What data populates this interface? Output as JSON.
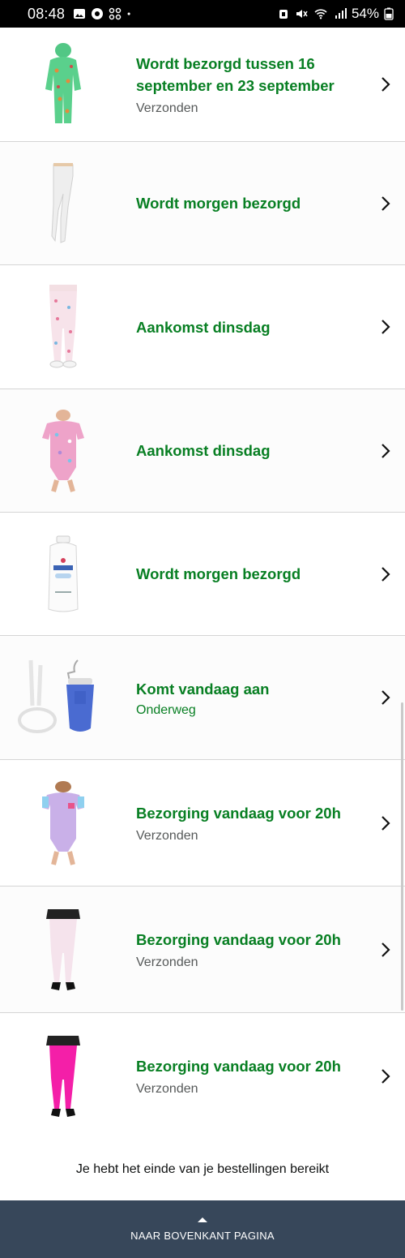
{
  "status_bar": {
    "time": "08:48",
    "battery": "54%",
    "left_icons": [
      "gallery-icon",
      "chrome-icon",
      "grid-icon",
      "dot-icon"
    ],
    "right_icons": [
      "alarm-icon",
      "mute-icon",
      "wifi-icon",
      "signal-icon",
      "battery-icon"
    ]
  },
  "orders": [
    {
      "status": "Wordt bezorgd tussen 16 september en 23 september",
      "sub": "Verzonden",
      "product_icon": "green-onesie-pajama"
    },
    {
      "status": "Wordt morgen bezorgd",
      "sub": "",
      "product_icon": "white-tights"
    },
    {
      "status": "Aankomst dinsdag",
      "sub": "",
      "product_icon": "printed-leggings"
    },
    {
      "status": "Aankomst dinsdag",
      "sub": "",
      "product_icon": "pink-printed-bodysuit"
    },
    {
      "status": "Wordt morgen bezorgd",
      "sub": "",
      "product_icon": "baby-powder-bottle"
    },
    {
      "status": "Komt vandaag aan",
      "sub": "Onderweg",
      "product_icon": "enema-bag-kit"
    },
    {
      "status": "Bezorging vandaag voor 20h",
      "sub": "Verzonden",
      "product_icon": "lilac-bodysuit"
    },
    {
      "status": "Bezorging vandaag voor 20h",
      "sub": "Verzonden",
      "product_icon": "white-tights-heels"
    },
    {
      "status": "Bezorging vandaag voor 20h",
      "sub": "Verzonden",
      "product_icon": "pink-tights-heels"
    }
  ],
  "footer": {
    "end_message": "Je hebt het einde van je bestellingen bereikt",
    "back_to_top": "NAAR BOVENKANT PAGINA"
  },
  "colors": {
    "status_green": "#087f23",
    "sub_gray": "#565959",
    "footer_bg": "#37475a"
  }
}
